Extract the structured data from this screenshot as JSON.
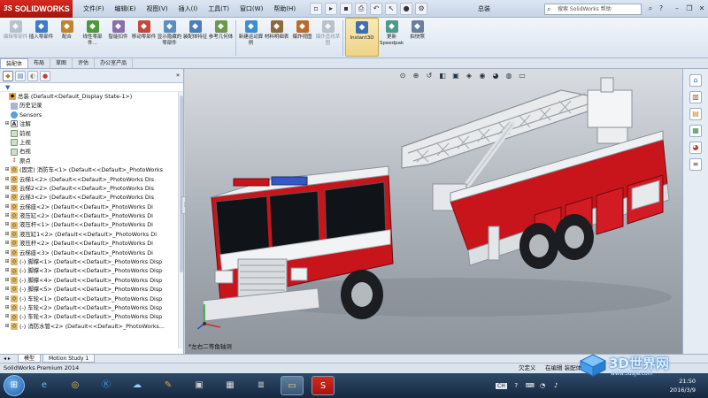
{
  "app": {
    "logo": "SOLIDWORKS",
    "doc_title": "总装"
  },
  "menu": [
    "文件(F)",
    "编辑(E)",
    "视图(V)",
    "插入(I)",
    "工具(T)",
    "窗口(W)",
    "帮助(H)"
  ],
  "search": {
    "placeholder": "搜索 SolidWorks 帮助"
  },
  "ribbon": [
    {
      "label": "编辑零部件",
      "icon": "edit-component-icon",
      "color": "#7a8796",
      "disabled": true
    },
    {
      "label": "插入零部件",
      "icon": "insert-component-icon",
      "color": "#3d7bc4"
    },
    {
      "label": "配合",
      "icon": "mate-icon",
      "color": "#c2872e"
    },
    {
      "label": "线性零部件...",
      "icon": "linear-pattern-icon",
      "color": "#4c9a3a"
    },
    {
      "label": "智能扣件",
      "icon": "smart-fastener-icon",
      "color": "#8a6fb0"
    },
    {
      "label": "移动零部件",
      "icon": "move-component-icon",
      "color": "#c44a3a"
    },
    {
      "label": "显示隐藏的零部件",
      "icon": "show-hidden-icon",
      "color": "#5a8fc0"
    },
    {
      "label": "装配体特征",
      "icon": "assembly-feature-icon",
      "color": "#4a7fb7"
    },
    {
      "label": "参考几何体",
      "icon": "reference-geometry-icon",
      "color": "#6a9a4a"
    },
    {
      "label": "新建运动算例",
      "icon": "motion-study-icon",
      "color": "#3b8fd0"
    },
    {
      "label": "材料明细表",
      "icon": "bom-icon",
      "color": "#8c6a3c"
    },
    {
      "label": "爆炸视图",
      "icon": "exploded-view-icon",
      "color": "#c06a2a"
    },
    {
      "label": "爆炸直线草图",
      "icon": "explode-line-sketch-icon",
      "color": "#7a8796",
      "disabled": true
    },
    {
      "label": "Instant3D",
      "icon": "instant3d-icon",
      "color": "#3e6fb0",
      "active": true
    },
    {
      "label": "更新Speedpak",
      "icon": "speedpak-icon",
      "color": "#4d9a8a"
    },
    {
      "label": "拍快照",
      "icon": "snapshot-icon",
      "color": "#6a7fa0"
    }
  ],
  "cm_tabs": [
    "装配体",
    "布局",
    "草图",
    "评估",
    "办公室产品"
  ],
  "tree": {
    "filter": "▼",
    "rows": [
      {
        "t": "总装  (Default<Default_Display State-1>)",
        "i": "asm",
        "g": "",
        "root": true
      },
      {
        "t": "历史记录",
        "i": "hist",
        "g": ""
      },
      {
        "t": "Sensors",
        "i": "sensor",
        "g": ""
      },
      {
        "t": "注解",
        "i": "annot",
        "g": "⊞"
      },
      {
        "t": "前视",
        "i": "plane",
        "g": ""
      },
      {
        "t": "上视",
        "i": "plane",
        "g": ""
      },
      {
        "t": "右视",
        "i": "plane",
        "g": ""
      },
      {
        "t": "原点",
        "i": "origin",
        "g": ""
      },
      {
        "t": "(固定) 消防车<1> (Default<<Default>_PhotoWorks",
        "i": "part",
        "g": "⊞"
      },
      {
        "t": "云梯1<2> (Default<<Default>_PhotoWorks Dis",
        "i": "part",
        "g": "⊞"
      },
      {
        "t": "云梯2<2> (Default<<Default>_PhotoWorks Dis",
        "i": "part",
        "g": "⊞"
      },
      {
        "t": "云梯3<2> (Default<<Default>_PhotoWorks Dis",
        "i": "part",
        "g": "⊞"
      },
      {
        "t": "云梯座<2> (Default<<Default>_PhotoWorks Di",
        "i": "part",
        "g": "⊞"
      },
      {
        "t": "液压缸<2> (Default<<Default>_PhotoWorks Di",
        "i": "part",
        "g": "⊞"
      },
      {
        "t": "液压杆<1> (Default<<Default>_PhotoWorks Di",
        "i": "part",
        "g": "⊞"
      },
      {
        "t": "液压缸1<2> (Default<<Default>_PhotoWorks Di",
        "i": "part",
        "g": "⊞"
      },
      {
        "t": "液压杆<2> (Default<<Default>_PhotoWorks Di",
        "i": "part",
        "g": "⊞"
      },
      {
        "t": "云梯座<3> (Default<<Default>_PhotoWorks Di",
        "i": "part",
        "g": "⊞"
      },
      {
        "t": "(-) 脚撑<1> (Default<<Default>_PhotoWorks Disp",
        "i": "part",
        "g": "⊞"
      },
      {
        "t": "(-) 脚撑<3> (Default<<Default>_PhotoWorks Disp",
        "i": "part",
        "g": "⊞"
      },
      {
        "t": "(-) 脚撑<4> (Default<<Default>_PhotoWorks Disp",
        "i": "part",
        "g": "⊞"
      },
      {
        "t": "(-) 脚撑<5> (Default<<Default>_PhotoWorks Disp",
        "i": "part",
        "g": "⊞"
      },
      {
        "t": "(-) 车轮<1> (Default<<Default>_PhotoWorks Disp",
        "i": "part",
        "g": "⊞"
      },
      {
        "t": "(-) 车轮<2> (Default<<Default>_PhotoWorks Disp",
        "i": "part",
        "g": "⊞"
      },
      {
        "t": "(-) 车轮<3> (Default<<Default>_PhotoWorks Disp",
        "i": "part",
        "g": "⊞"
      },
      {
        "t": "(-) 消防水管<2> (Default<<Default>_PhotoWorks...",
        "i": "part",
        "g": "⊞"
      }
    ]
  },
  "viewport": {
    "view_label": "*左右二等角轴测"
  },
  "bottom_tabs": [
    "模型",
    "Motion Study 1"
  ],
  "status": {
    "app": "SolidWorks Premium 2014",
    "definition": "欠定义",
    "editing": "在编辑 装配体"
  },
  "taskbar": {
    "lang": "CH",
    "time": "21:50",
    "date": "2016/3/9"
  },
  "watermark": {
    "text": "3D世界网",
    "url": "www.3dsjw.com"
  },
  "colors": {
    "accent": "#c8151c",
    "ribbon_active": "#efd487",
    "taskbar": "#1d334d"
  }
}
